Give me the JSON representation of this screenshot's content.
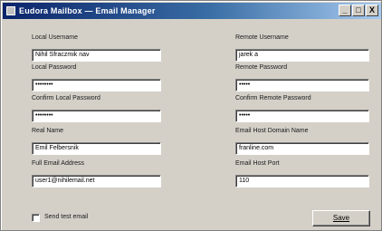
{
  "window": {
    "title": "Eudora Mailbox — Email Manager",
    "minimize": "_",
    "maximize": "□",
    "close": "X"
  },
  "left": [
    {
      "label": "Local Username",
      "value": "Nihil Sfraczmik nav"
    },
    {
      "label": "Local Password",
      "value": "••••••••"
    },
    {
      "label": "Confirm Local Password",
      "value": "••••••••"
    },
    {
      "label": "Real Name",
      "value": "Emil Felbersnik"
    },
    {
      "label": "Full Email Address",
      "value": "user1@nihilemail.net"
    }
  ],
  "right": [
    {
      "label": "Remote Username",
      "value": "jarek a"
    },
    {
      "label": "Remote Password",
      "value": "•••••"
    },
    {
      "label": "Confirm Remote Password",
      "value": "•••••"
    },
    {
      "label": "Email Host Domain Name",
      "value": "franline.com"
    },
    {
      "label": "Email Host Port",
      "value": "110"
    }
  ],
  "options": {
    "sendtest_label": "Send test email",
    "sendtest_checked": false
  },
  "actions": {
    "save_label": "Save"
  },
  "icons": {
    "app": "app-icon"
  }
}
